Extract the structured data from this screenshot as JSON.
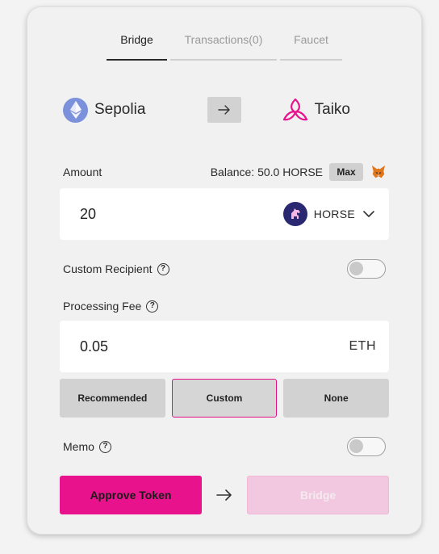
{
  "tabs": [
    {
      "label": "Bridge",
      "active": true
    },
    {
      "label": "Transactions(0)",
      "active": false
    },
    {
      "label": "Faucet",
      "active": false
    }
  ],
  "chains": {
    "from": {
      "name": "Sepolia",
      "icon": "ethereum-icon"
    },
    "to": {
      "name": "Taiko",
      "icon": "taiko-icon"
    },
    "swap_icon": "arrow-right-icon"
  },
  "amount": {
    "label": "Amount",
    "balance_text": "Balance: 50.0 HORSE",
    "max_label": "Max",
    "wallet_icon": "metamask-fox-icon",
    "value": "20",
    "token": "HORSE",
    "token_icon": "horse-icon",
    "dropdown_icon": "chevron-down-icon"
  },
  "custom_recipient": {
    "label": "Custom Recipient",
    "enabled": false
  },
  "processing_fee": {
    "label": "Processing Fee",
    "value": "0.05",
    "unit": "ETH",
    "options": [
      {
        "label": "Recommended",
        "selected": false
      },
      {
        "label": "Custom",
        "selected": true
      },
      {
        "label": "None",
        "selected": false
      }
    ]
  },
  "memo": {
    "label": "Memo",
    "enabled": false
  },
  "actions": {
    "approve_label": "Approve Token",
    "bridge_label": "Bridge",
    "bridge_disabled": true
  },
  "colors": {
    "accent": "#e8128d",
    "accent_disabled": "#f2c8e0",
    "card_bg": "#f1f1f1",
    "button_gray": "#d2d2d2"
  }
}
